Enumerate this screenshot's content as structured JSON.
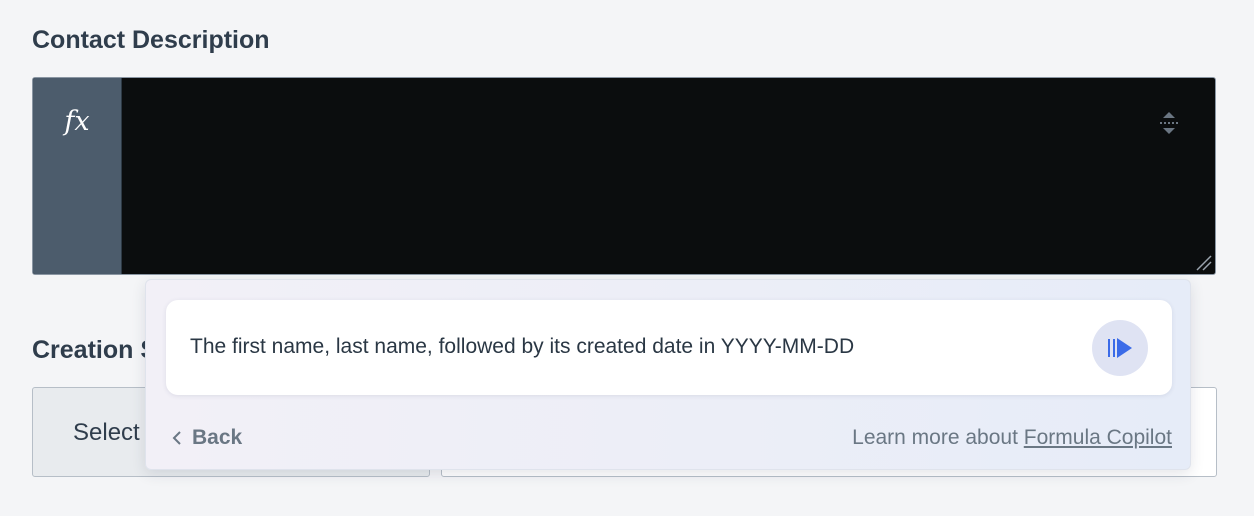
{
  "fields": {
    "contact_description": {
      "label": "Contact Description",
      "gutter_icon": "fx",
      "value": ""
    },
    "creation": {
      "label_visible": "Creation S",
      "select_value_visible": "Select"
    }
  },
  "copilot": {
    "prompt": "The first name, last name, followed by its created date in YYYY-MM-DD",
    "back_label": "Back",
    "learn_more_prefix": "Learn more about",
    "learn_more_link": "Formula Copilot"
  },
  "icons": {
    "fx": "fx-icon",
    "expand": "expand-collapse-icon",
    "resize": "resize-handle-icon",
    "send": "send-icon",
    "back": "chevron-left-icon"
  },
  "colors": {
    "editor_bg": "#0b0d0e",
    "gutter_bg": "#4c5c6c",
    "send_accent": "#3b6be8",
    "page_bg": "#f4f5f7"
  }
}
